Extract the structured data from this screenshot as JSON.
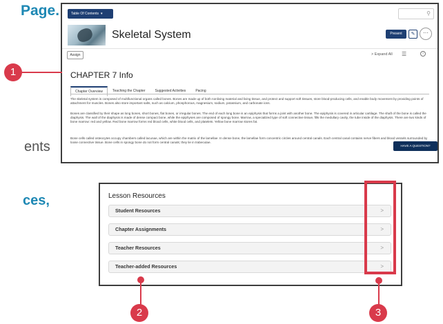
{
  "background_text": {
    "page": "Page.",
    "ents": "ents",
    "ces": "ces,"
  },
  "screen1": {
    "toc_label": "Table Of Contents",
    "toc_caret": "▾",
    "search_icon": "magnifier-icon",
    "title": "Skeletal System",
    "present_label": "Present",
    "edit_glyph": "✎",
    "more_glyph": "···",
    "assign_label": "Assign",
    "expand_all_label": "> Expand All",
    "list_glyph": "☰",
    "info_glyph": "i",
    "chapter_title": "CHAPTER 7 Info",
    "tabs": [
      "Chapter Overview",
      "Teaching the Chapter",
      "Suggested Activities",
      "Pacing"
    ],
    "paragraphs": [
      "The skeletal system is composed of multifunctional organs called bones. Bones are made up of both nonliving material and living tissue, and protect and support soft tissues, store blood-producing cells, and enable body movement by providing points of attachment for muscles. Bones also store important salts, such as calcium, phosphorous, magnesium, sodium, potassium, and carbonate ions.",
      "Bones are classified by their shape as long bones, short bones, flat bones, or irregular bones. The end of each long bone is an epiphysis that forms a joint with another bone. The epiphysis is covered in articular cartilage. The shaft of the bone is called the diaphysis. The wall of the diaphysis is made of dense compact bone, while the epiphyses are composed of spongy bone. Marrow, a specialized type of soft connective tissue, fills the medullary cavity, the tube inside of the diaphysis. There are two kinds of bone marrow: red and yellow. Red bone marrow forms red blood cells, white blood cells, and platelets. Yellow bone marrow stores fat.",
      "Bone cells called osteocytes occupy chambers called lacunae, which are within the matrix of the lamellae. In dense bone, the lamellae form concentric circles around central canals. Each central canal contains nerve fibers and blood vessels surrounded by loose connective tissue. Bone cells in spongy bone do not form central canals; they lie in trabeculae."
    ],
    "help_button": "HAVE A QUESTION?"
  },
  "lesson_resources": {
    "title": "Lesson Resources",
    "chevron": ">",
    "items": [
      {
        "label": "Student Resources"
      },
      {
        "label": "Chapter Assignments"
      },
      {
        "label": "Teacher Resources"
      },
      {
        "label": "Teacher-added Resources"
      }
    ]
  },
  "callouts": {
    "one": "1",
    "two": "2",
    "three": "3"
  },
  "colors": {
    "callout": "#d93a4b",
    "navy": "#1e3f73",
    "brand_text": "#1e88b4"
  }
}
